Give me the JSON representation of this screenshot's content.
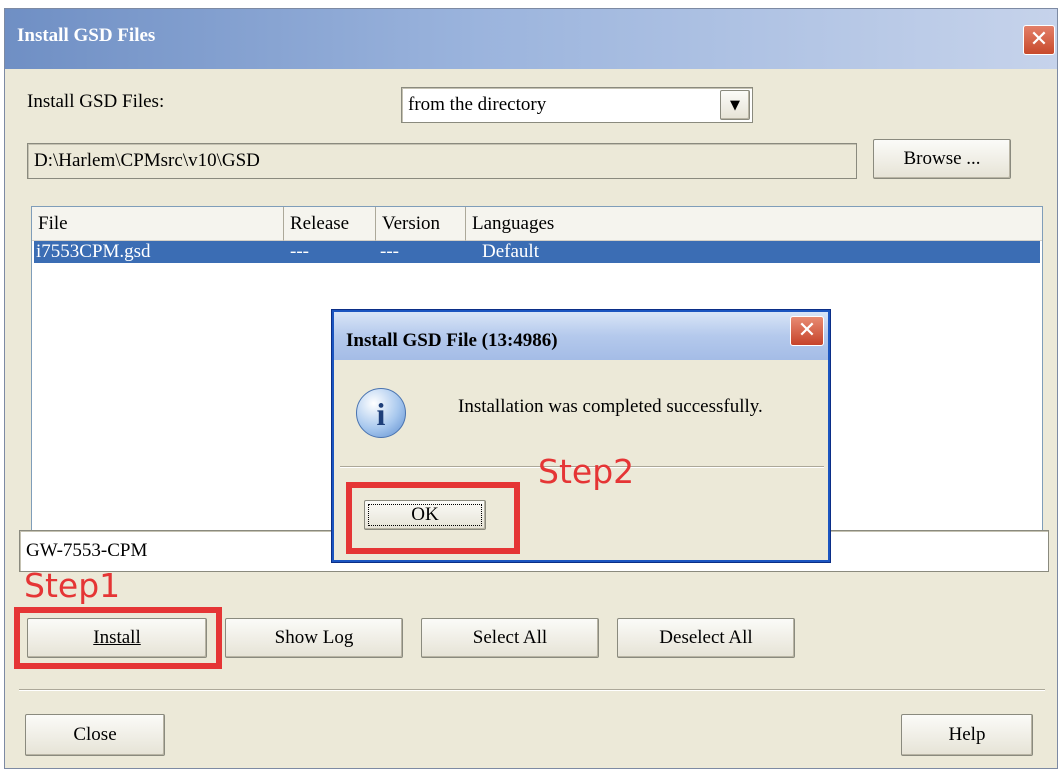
{
  "window": {
    "title": "Install GSD Files",
    "close_glyph": "✕"
  },
  "install_row": {
    "label": "Install GSD Files:",
    "source_value": "from the directory",
    "dropdown_glyph": "▼"
  },
  "path": {
    "value": "D:\\Harlem\\CPMsrc\\v10\\GSD",
    "browse_label": "Browse ..."
  },
  "file_list": {
    "columns": [
      "File",
      "Release",
      "Version",
      "Languages"
    ],
    "rows": [
      {
        "file": "i7553CPM.gsd",
        "release": "---",
        "version": "---",
        "languages": "Default",
        "selected": true
      }
    ]
  },
  "device_name": "GW-7553-CPM",
  "actions": {
    "install": "Install",
    "show_log": "Show Log",
    "select_all": "Select All",
    "deselect_all": "Deselect All"
  },
  "footer": {
    "close": "Close",
    "help": "Help"
  },
  "modal": {
    "title": "Install GSD File (13:4986)",
    "message": "Installation was completed successfully.",
    "ok_label": "OK",
    "close_glyph": "✕",
    "icon_glyph": "i",
    "icon": "information-icon"
  },
  "annotations": {
    "step1": "Step1",
    "step2": "Step2",
    "color": "#e53535"
  }
}
